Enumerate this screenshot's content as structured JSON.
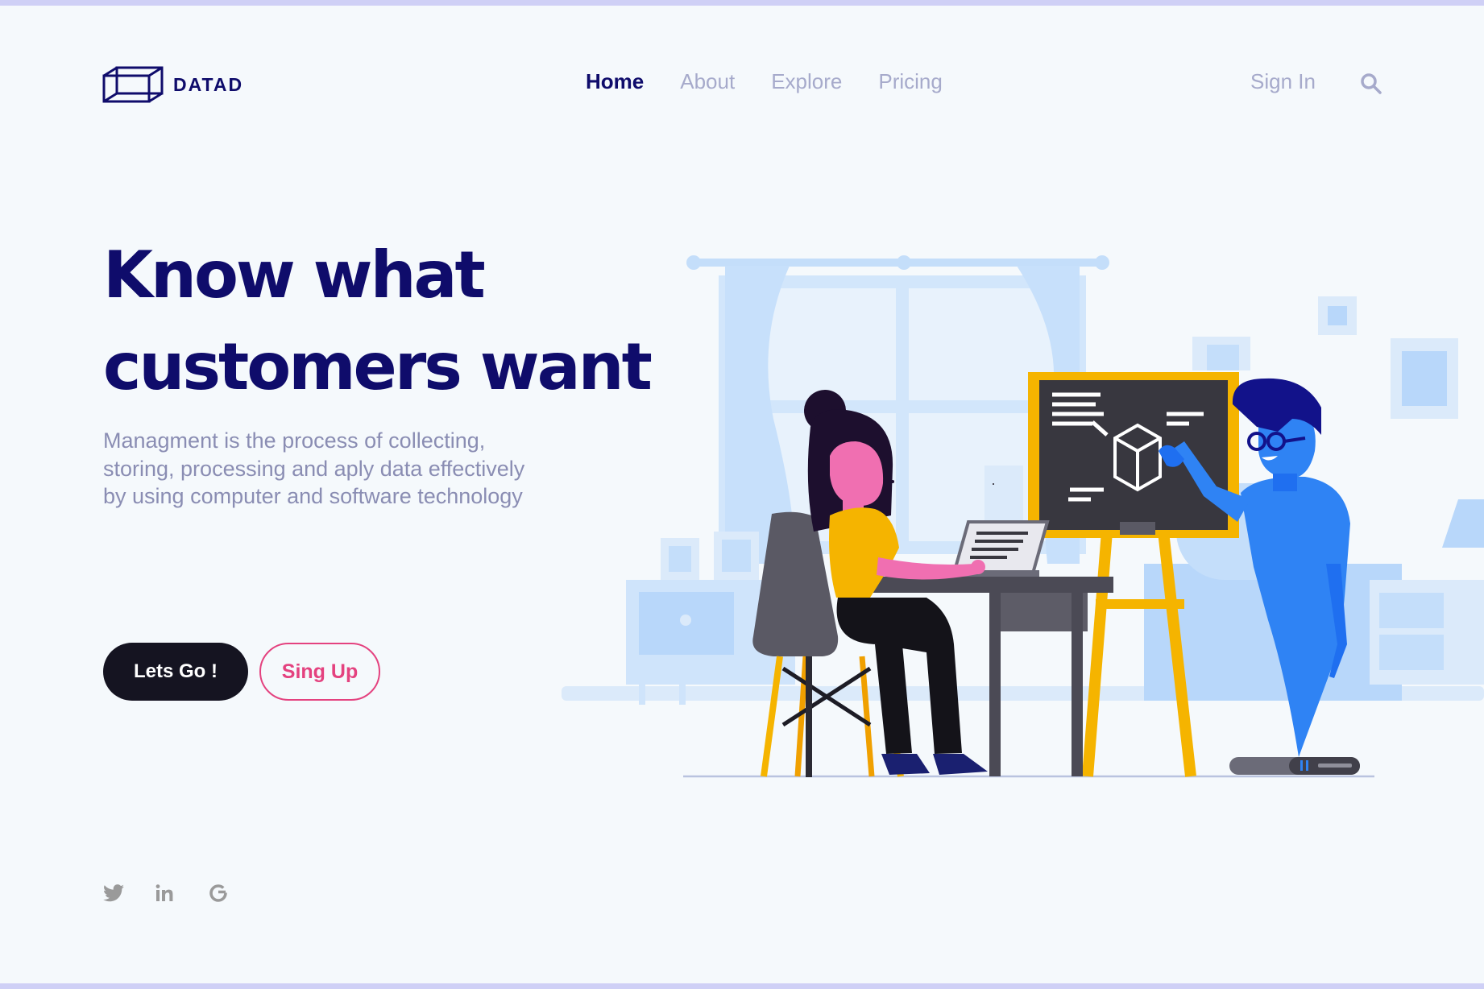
{
  "brand": {
    "name": "DATAD"
  },
  "nav": {
    "items": [
      "Home",
      "About",
      "Explore",
      "Pricing"
    ],
    "active": "Home"
  },
  "auth": {
    "sign_in": "Sign In"
  },
  "hero": {
    "title_line1": "Know what",
    "title_line2": "customers want",
    "description": "Managment is the process of collecting, storing, processing and aply data effectively by using computer and software technology",
    "primary_cta": "Lets Go !",
    "secondary_cta": "Sing Up"
  },
  "social": [
    "twitter-icon",
    "linkedin-icon",
    "google-icon"
  ],
  "colors": {
    "brand_navy": "#0f0c6b",
    "muted_text": "#8a8db3",
    "nav_inactive": "#a6aacb",
    "accent_pink": "#e4427f",
    "button_dark": "#151421",
    "background": "#f5f9fc",
    "illustration_blue": "#1f6ff0",
    "illustration_yellow": "#f5b400"
  }
}
